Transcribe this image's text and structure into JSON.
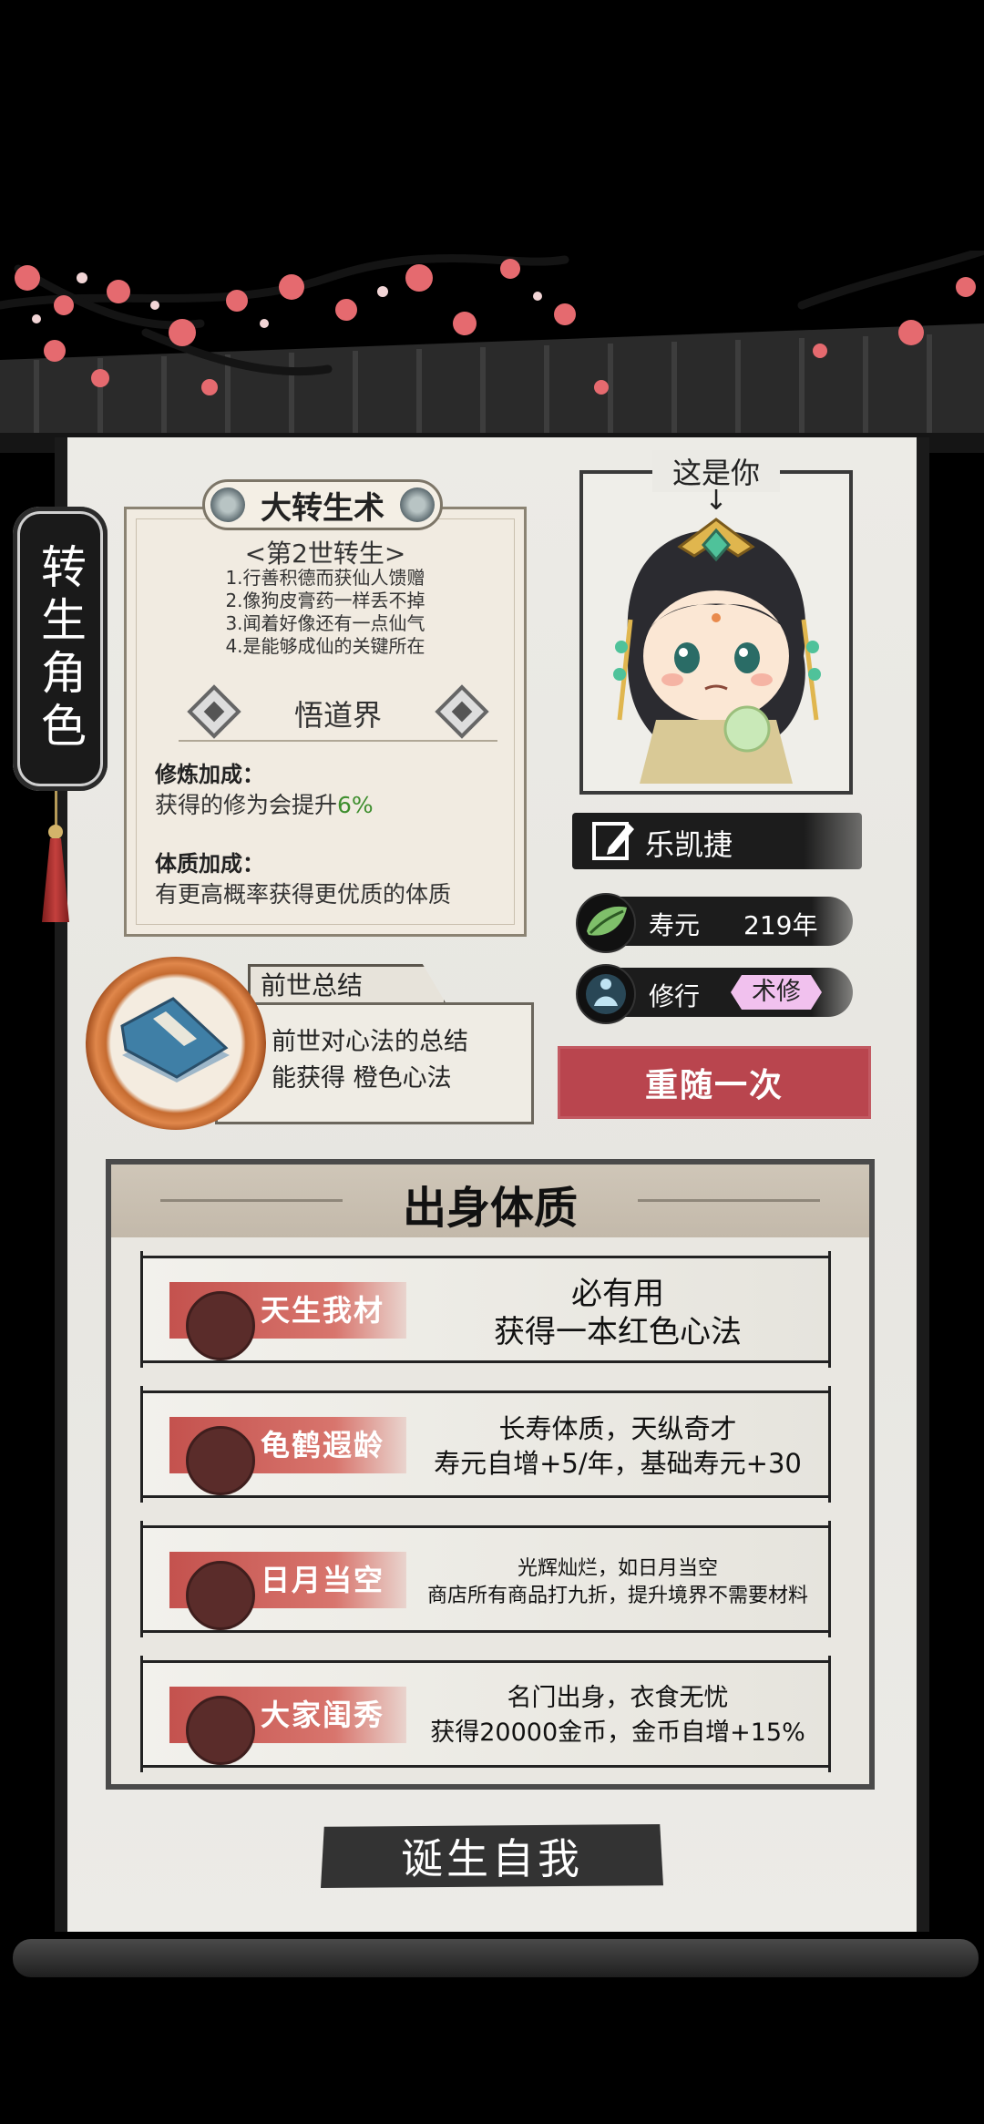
{
  "side_banner": "转生角色",
  "skill": {
    "title": "大转生术",
    "generation": "<第2世转生>",
    "items": [
      "1.行善积德而获仙人馈赠",
      "2.像狗皮膏药一样丢不掉",
      "3.闻着好像还有一点仙气",
      "4.是能够成仙的关键所在"
    ],
    "realm": "悟道界",
    "cultivation_title": "修炼加成：",
    "cultivation_desc_prefix": "获得的修为会提升",
    "cultivation_pct": "6%",
    "physique_title": "体质加成：",
    "physique_desc": "有更高概率获得更优质的体质"
  },
  "portrait": {
    "caption": "这是你",
    "arrow": "↓"
  },
  "character": {
    "name": "乐凯捷",
    "lifespan_label": "寿元",
    "lifespan_value": "219年",
    "cultivation_label": "修行",
    "cultivation_type": "术修"
  },
  "reroll_label": "重随一次",
  "past_life": {
    "tab_label": "前世总结",
    "desc_line1": "前世对心法的总结",
    "desc_line2": "能获得 橙色心法"
  },
  "origin": {
    "title": "出身体质",
    "traits": [
      {
        "name": "天生我材",
        "line1": "必有用",
        "line2": "获得一本红色心法"
      },
      {
        "name": "龟鹤遐龄",
        "line1": "长寿体质，天纵奇才",
        "line2": "寿元自增+5/年，基础寿元+30"
      },
      {
        "name": "日月当空",
        "line1": "光辉灿烂，如日月当空",
        "line2": "商店所有商品打九折，提升境界不需要材料"
      },
      {
        "name": "大家闺秀",
        "line1": "名门出身，衣食无忧",
        "line2": "获得20000金币，金币自增+15%"
      }
    ]
  },
  "birth_label": "诞生自我",
  "colors": {
    "accent_red": "#b9454e",
    "trait_red": "#c4524e",
    "highlight_green": "#3e8e2e",
    "badge_pink": "#f1c1ee"
  }
}
